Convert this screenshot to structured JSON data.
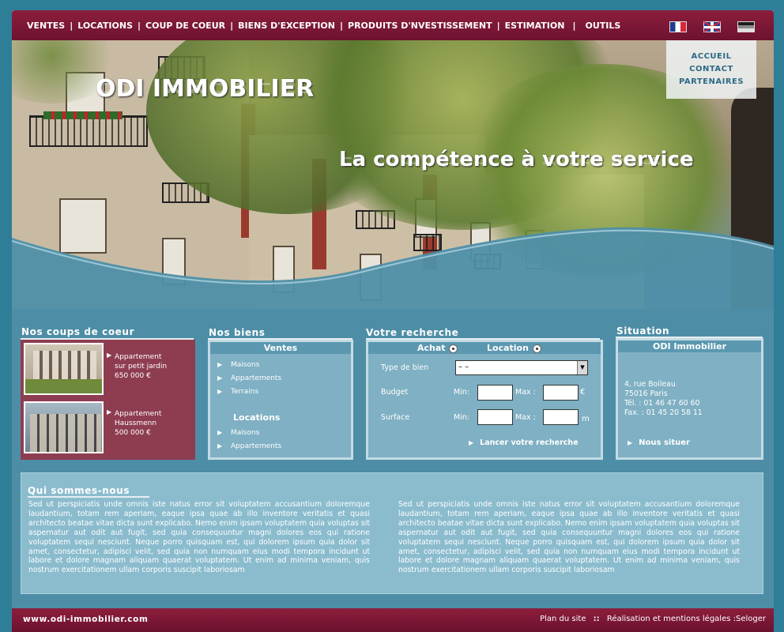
{
  "nav": {
    "items": [
      "VENTES",
      "LOCATIONS",
      "COUP DE COEUR",
      "BIENS D'EXCEPTION",
      "PRODUITS D'NVESTISSEMENT",
      "ESTIMATION",
      "OUTILS"
    ],
    "separator": "|",
    "languages": [
      "flag-fr-icon",
      "flag-uk-icon",
      "flag-de-icon"
    ]
  },
  "side_menu": [
    "ACCUEIL",
    "CONTACT",
    "PARTENAIRES"
  ],
  "hero": {
    "logo": "ODI IMMOBILIER",
    "slogan": "La compétence à votre service"
  },
  "coeur": {
    "title": "Nos coups de coeur",
    "items": [
      {
        "lines": [
          "Appartement",
          "sur petit jardin",
          "650 000 €"
        ]
      },
      {
        "lines": [
          "Appartement",
          "Haussmenn",
          "500 000 €"
        ]
      }
    ]
  },
  "biens": {
    "title": "Nos biens",
    "ventes_label": "Ventes",
    "ventes": [
      "Maisons",
      "Appartements",
      "Terrains"
    ],
    "locations_label": "Locations",
    "locations": [
      "Maisons",
      "Appartements"
    ]
  },
  "recherche": {
    "title": "Votre recherche",
    "achat": "Achat",
    "location": "Location",
    "type_label": "Type de bien",
    "type_value": "– –",
    "budget_label": "Budget",
    "surface_label": "Surface",
    "min": "Min:",
    "max": "Max :",
    "currency": "€",
    "unit_surface": "m",
    "submit": "Lancer votre recherche"
  },
  "situation": {
    "title": "Situation",
    "name": "ODI Immobilier",
    "address": [
      "4, rue Boileau",
      "75016 Paris",
      "Tél. : 01 46 47 60 60",
      "Fax. : 01 45 20 58 11"
    ],
    "link": "Nous situer"
  },
  "qui": {
    "title": "Qui sommes-nous",
    "para1": "Sed ut perspiciatis unde omnis iste natus error sit voluptatem accusantium doloremque laudantium, totam rem aperiam, eaque ipsa quae ab illo inventore veritatis et quasi architecto beatae vitae dicta sunt explicabo. Nemo enim ipsam voluptatem quia voluptas sit aspernatur aut odit aut fugit, sed quia consequuntur magni dolores eos qui ratione voluptatem sequi nesciunt. Neque porro quisquam est, qui dolorem ipsum quia dolor sit amet, consectetur, adipisci velit, sed quia non numquam eius modi tempora incidunt ut labore et dolore magnam aliquam quaerat voluptatem. Ut enim ad minima veniam, quis nostrum exercitationem ullam corporis suscipit laboriosam",
    "para2": "Sed ut perspiciatis unde omnis iste natus error sit voluptatem accusantium doloremque laudantium, totam rem aperiam, eaque ipsa quae ab illo inventore veritatis et quasi architecto beatae vitae dicta sunt explicabo. Nemo enim ipsam voluptatem quia voluptas sit aspernatur aut odit aut fugit, sed quia consequuntur magni dolores eos qui ratione voluptatem sequi nesciunt. Neque porro quisquam est, qui dolorem ipsum quia dolor sit amet, consectetur, adipisci velit, sed quia non numquam eius modi tempora incidunt ut labore et dolore magnam aliquam quaerat voluptatem. Ut enim ad minima veniam, quis nostrum exercitationem ullam corporis suscipit laboriosam"
  },
  "footer": {
    "url": "www.odi-immobilier.com",
    "plan": "Plan du site",
    "sep": "::",
    "legal": "Réalisation et mentions légales :Seloger"
  },
  "colors": {
    "bordeaux": "#7a1735",
    "blue_bg": "#2f7e98",
    "panel_blue": "#7fb0c3",
    "coeur_bg": "#8e3d51"
  }
}
